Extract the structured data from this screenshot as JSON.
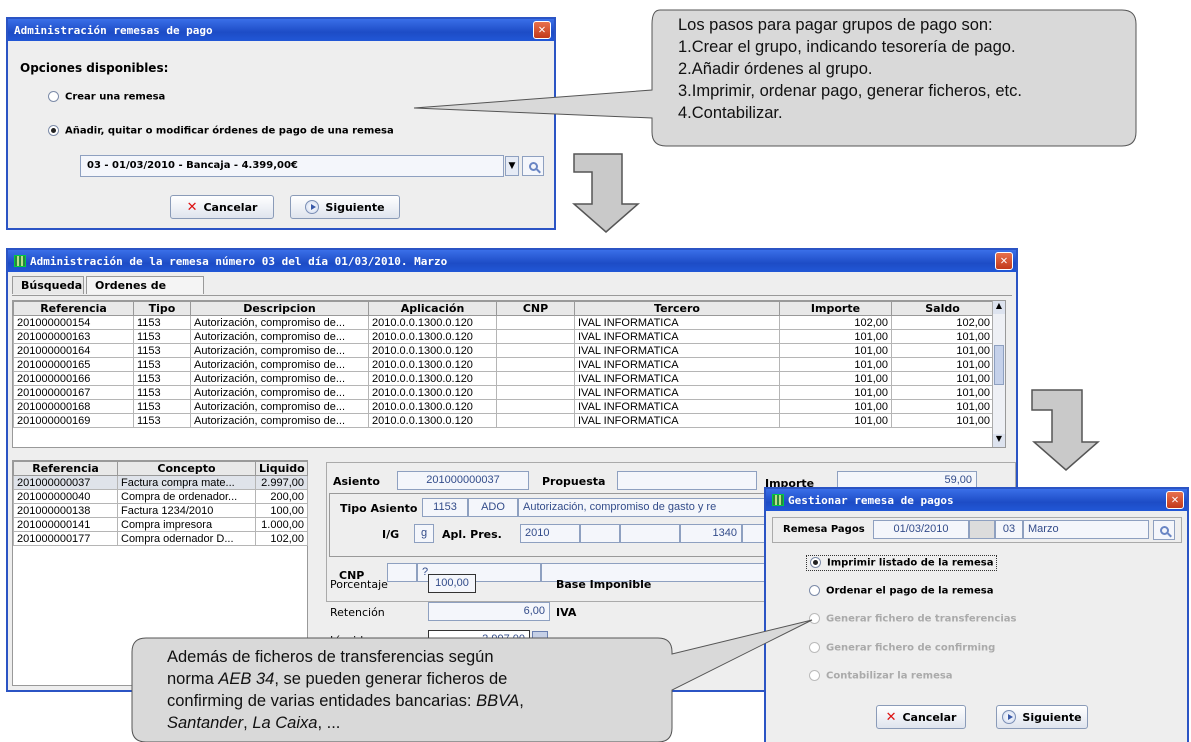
{
  "dialog1": {
    "title": "Administración remesas de pago",
    "heading": "Opciones disponibles:",
    "option1": "Crear una remesa",
    "option2": "Añadir, quitar o modificar órdenes de pago de una remesa",
    "combo_value": "03 - 01/03/2010 - Bancaja - 4.399,00€",
    "cancel": "Cancelar",
    "next": "Siguiente"
  },
  "callout_top": {
    "lines": [
      "Los pasos para pagar grupos de pago son:",
      "1.Crear el grupo, indicando tesorería de pago.",
      "2.Añadir órdenes al grupo.",
      "3.Imprimir, ordenar pago, generar ficheros, etc.",
      "4.Contabilizar."
    ]
  },
  "main_window": {
    "title": "Administración de la remesa número 03 del día 01/03/2010. Marzo",
    "tabs": [
      "Búsqueda",
      "Ordenes de pago"
    ],
    "top_table": {
      "headers": [
        "Referencia",
        "Tipo",
        "Descripcion",
        "Aplicación",
        "CNP",
        "Tercero",
        "Importe",
        "Saldo"
      ],
      "rows": [
        [
          "201000000154",
          "1153",
          "Autorización, compromiso de...",
          "2010.0.0.1300.0.120",
          "",
          "IVAL INFORMATICA",
          "102,00",
          "102,00"
        ],
        [
          "201000000163",
          "1153",
          "Autorización, compromiso de...",
          "2010.0.0.1300.0.120",
          "",
          "IVAL INFORMATICA",
          "101,00",
          "101,00"
        ],
        [
          "201000000164",
          "1153",
          "Autorización, compromiso de...",
          "2010.0.0.1300.0.120",
          "",
          "IVAL INFORMATICA",
          "101,00",
          "101,00"
        ],
        [
          "201000000165",
          "1153",
          "Autorización, compromiso de...",
          "2010.0.0.1300.0.120",
          "",
          "IVAL INFORMATICA",
          "101,00",
          "101,00"
        ],
        [
          "201000000166",
          "1153",
          "Autorización, compromiso de...",
          "2010.0.0.1300.0.120",
          "",
          "IVAL INFORMATICA",
          "101,00",
          "101,00"
        ],
        [
          "201000000167",
          "1153",
          "Autorización, compromiso de...",
          "2010.0.0.1300.0.120",
          "",
          "IVAL INFORMATICA",
          "101,00",
          "101,00"
        ],
        [
          "201000000168",
          "1153",
          "Autorización, compromiso de...",
          "2010.0.0.1300.0.120",
          "",
          "IVAL INFORMATICA",
          "101,00",
          "101,00"
        ],
        [
          "201000000169",
          "1153",
          "Autorización, compromiso de...",
          "2010.0.0.1300.0.120",
          "",
          "IVAL INFORMATICA",
          "101,00",
          "101,00"
        ]
      ]
    },
    "left_table": {
      "headers": [
        "Referencia",
        "Concepto",
        "Liquido"
      ],
      "rows": [
        [
          "201000000037",
          "Factura compra  mate...",
          "2.997,00"
        ],
        [
          "201000000040",
          "Compra de ordenador...",
          "200,00"
        ],
        [
          "201000000138",
          "Factura 1234/2010",
          "100,00"
        ],
        [
          "201000000141",
          "Compra impresora",
          "1.000,00"
        ],
        [
          "201000000177",
          "Compra odernador D...",
          "102,00"
        ]
      ]
    },
    "detail": {
      "asiento_label": "Asiento",
      "asiento_value": "201000000037",
      "propuesta_label": "Propuesta",
      "importe_label": "Importe",
      "importe_value": "59,00",
      "tipo_asiento_label": "Tipo Asiento",
      "tipo_asiento_value": "1153",
      "ado": "ADO",
      "tipo_desc": "Autorización, compromiso de gasto y re",
      "ig_label": "I/G",
      "ig_value": "g",
      "apl_pres_label": "Apl. Pres.",
      "apl_year": "2010",
      "apl_code": "1340",
      "cnp_label": "CNP",
      "cnp_value": "?",
      "porcentaje_label": "Porcentaje",
      "porcentaje_value": "100,00",
      "base_imponible_label": "Base Imponible",
      "retencion_label": "Retención",
      "retencion_value": "6,00",
      "iva_label": "IVA",
      "liquido_label": "Líquido",
      "liquido_value": "2.997,00"
    }
  },
  "gestionar": {
    "title": "Gestionar remesa de pagos",
    "remesa_label": "Remesa Pagos",
    "remesa_date": "01/03/2010",
    "remesa_num": "03",
    "remesa_month": "Marzo",
    "options": [
      "Imprimir listado de la remesa",
      "Ordenar el pago de la remesa",
      "Generar fichero de transferencias",
      "Generar fichero de confirming",
      "Contabilizar la remesa"
    ],
    "cancel": "Cancelar",
    "next": "Siguiente"
  },
  "callout_bottom": {
    "line1": "Además de ficheros de transferencias según",
    "line2_pre": "norma ",
    "line2_em": "AEB 34",
    "line2_post": ", se pueden generar ficheros de",
    "line3_pre": "confirming de varias entidades bancarias: ",
    "line3_em": "BBVA",
    "line3_post": ",",
    "line4_em1": "Santander",
    "line4_mid": ", ",
    "line4_em2": "La Caixa",
    "line4_post": ", ..."
  }
}
